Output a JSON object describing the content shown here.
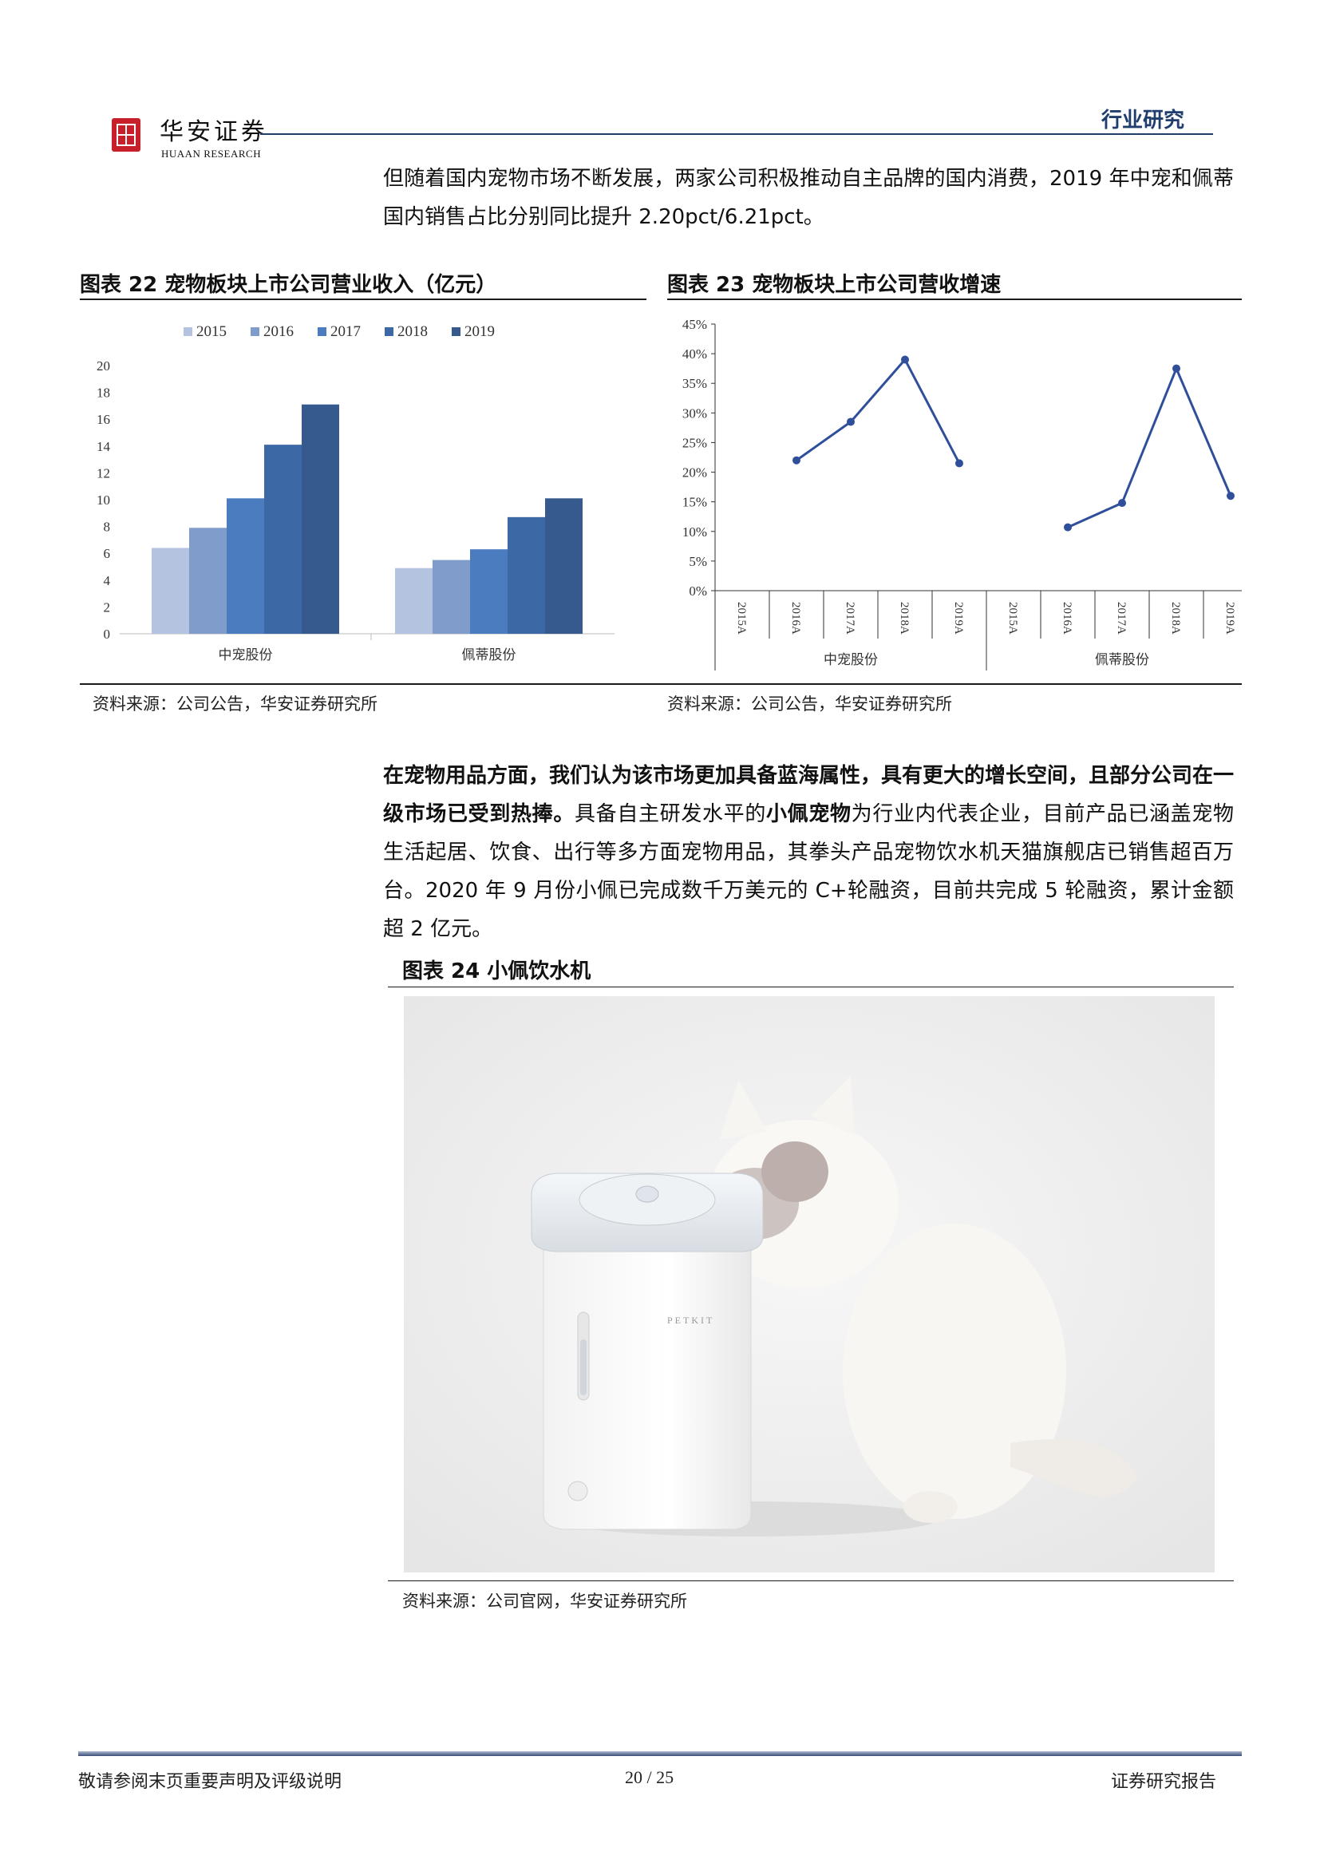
{
  "header": {
    "brand_cn": "华安证券",
    "brand_en": "HUAAN RESEARCH",
    "section_tag": "行业研究"
  },
  "intro_paragraph": "但随着国内宠物市场不断发展，两家公司积极推动自主品牌的国内消费，2019 年中宠和佩蒂国内销售占比分别同比提升 2.20pct/6.21pct。",
  "figure22": {
    "title": "图表 22  宠物板块上市公司营业收入（亿元）",
    "source": "资料来源：公司公告，华安证券研究所"
  },
  "figure23": {
    "title": "图表 23  宠物板块上市公司营收增速",
    "source": "资料来源：公司公告，华安证券研究所"
  },
  "chart_data": [
    {
      "type": "bar",
      "title": "",
      "categories": [
        "中宠股份",
        "佩蒂股份"
      ],
      "series": [
        {
          "name": "2015",
          "color": "#b4c4e0",
          "values": [
            6.4,
            4.9
          ]
        },
        {
          "name": "2016",
          "color": "#7f9ccb",
          "values": [
            7.9,
            5.5
          ]
        },
        {
          "name": "2017",
          "color": "#4b7cc0",
          "values": [
            10.1,
            6.3
          ]
        },
        {
          "name": "2018",
          "color": "#3d68a6",
          "values": [
            14.1,
            8.7
          ]
        },
        {
          "name": "2019",
          "color": "#365a8e",
          "values": [
            17.1,
            10.1
          ]
        }
      ],
      "ylim": [
        0,
        20
      ],
      "yticks": [
        0,
        2,
        4,
        6,
        8,
        10,
        12,
        14,
        16,
        18,
        20
      ],
      "legend": "top",
      "grid": false
    },
    {
      "type": "line",
      "title": "",
      "groups": [
        {
          "name": "中宠股份",
          "x": [
            "2015A",
            "2016A",
            "2017A",
            "2018A",
            "2019A"
          ],
          "values": [
            null,
            0.22,
            0.285,
            0.39,
            0.215
          ]
        },
        {
          "name": "佩蒂股份",
          "x": [
            "2015A",
            "2016A",
            "2017A",
            "2018A",
            "2019A"
          ],
          "values": [
            null,
            0.107,
            0.148,
            0.375,
            0.16
          ]
        }
      ],
      "color": "#2f4f9a",
      "ylim": [
        0,
        0.45
      ],
      "yticks": [
        "0%",
        "5%",
        "10%",
        "15%",
        "20%",
        "25%",
        "30%",
        "35%",
        "40%",
        "45%"
      ],
      "grid": false
    }
  ],
  "body_paragraph": {
    "bold_1": "在宠物用品方面，我们认为该市场更加具备蓝海属性，具有更大的增长空间，且部分公司在一级市场已受到热捧。",
    "text_1": "具备自主研发水平的",
    "bold_2": "小佩宠物",
    "text_2": "为行业内代表企业，目前产品已涵盖宠物生活起居、饮食、出行等多方面宠物用品，其拳头产品宠物饮水机天猫旗舰店已销售超百万台。2020 年 9 月份小佩已完成数千万美元的 C+轮融资，目前共完成 5 轮融资，累计金额超 2 亿元。"
  },
  "figure24": {
    "title": "图表 24  小佩饮水机",
    "product_logo": "PETKIT",
    "source": "资料来源：公司官网，华安证券研究所"
  },
  "footer": {
    "left": "敬请参阅末页重要声明及评级说明",
    "page": "20 / 25",
    "right": "证券研究报告"
  }
}
